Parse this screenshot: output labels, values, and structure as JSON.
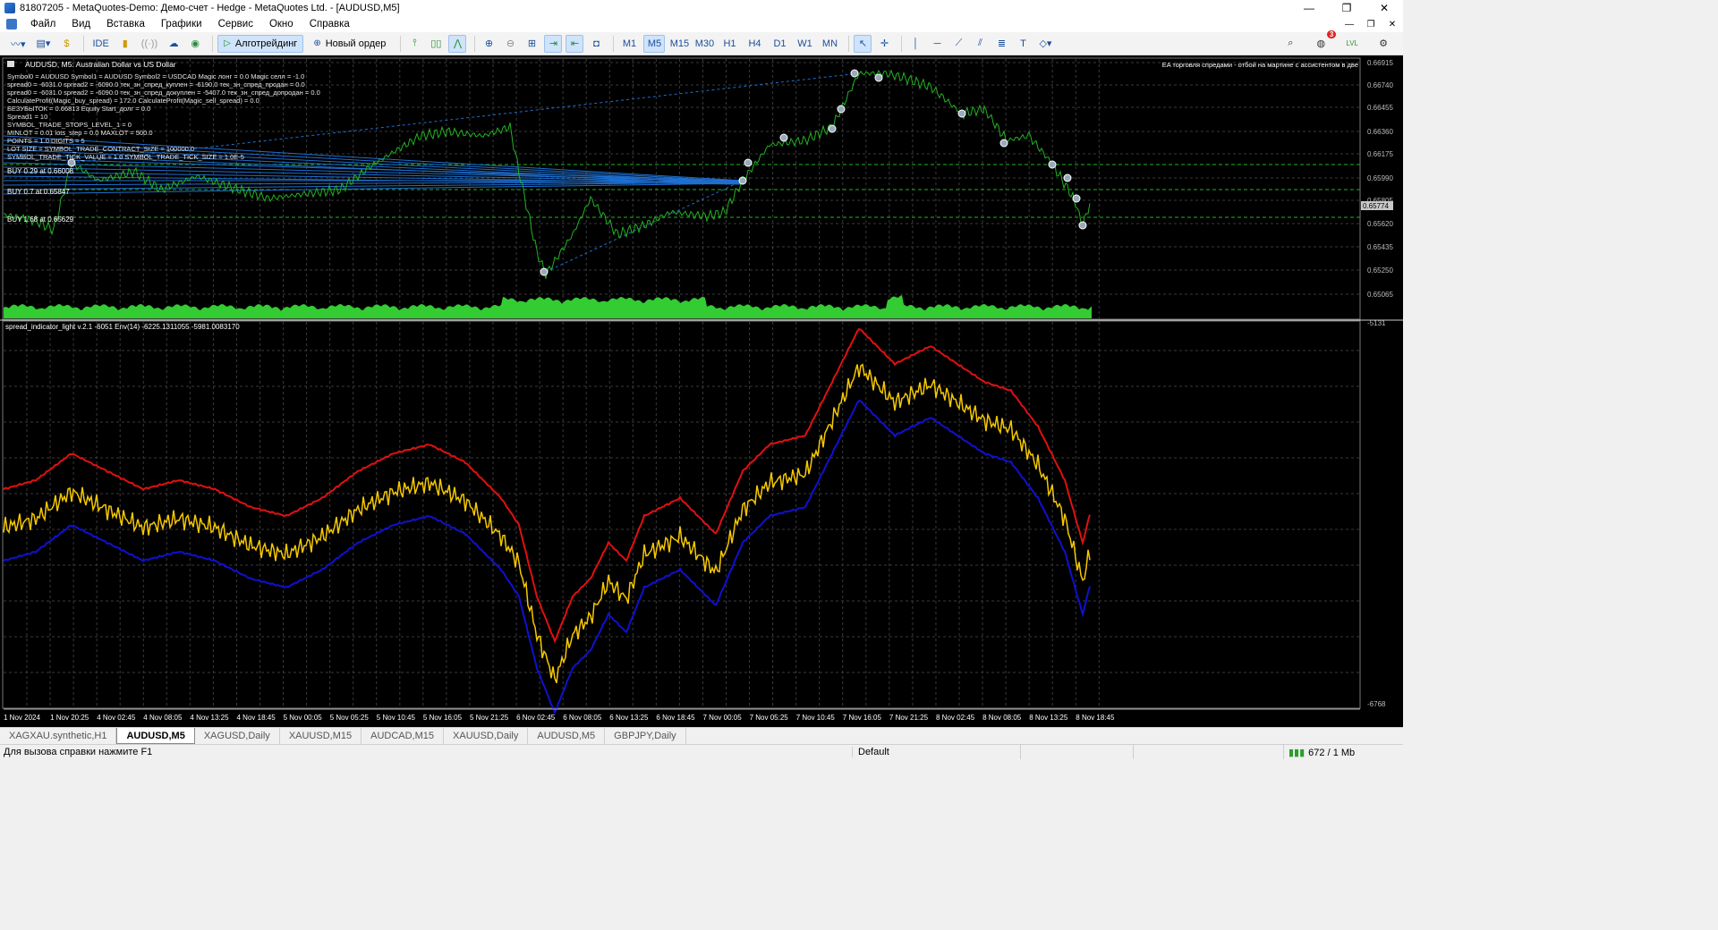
{
  "window": {
    "title": "81807205 - MetaQuotes-Demo: Демо-счет - Hedge - MetaQuotes Ltd. - [AUDUSD,M5]",
    "controls": [
      "—",
      "❐",
      "✕"
    ]
  },
  "menu": {
    "items": [
      "Файл",
      "Вид",
      "Вставка",
      "Графики",
      "Сервис",
      "Окно",
      "Справка"
    ],
    "mdi_controls": [
      "—",
      "❐",
      "✕"
    ]
  },
  "toolbar": {
    "ide_label": "IDE",
    "algotrading_label": "Алготрейдинг",
    "new_order_label": "Новый ордер",
    "timeframes": [
      "M1",
      "M5",
      "M15",
      "M30",
      "H1",
      "H4",
      "D1",
      "W1",
      "MN"
    ],
    "active_timeframe": "M5",
    "notifications_count": "3",
    "lvl_label": "LVL"
  },
  "chart": {
    "symbol_header": "AUDUSD, M5:  Australian Dollar vs US Dollar",
    "ea_label": "EA торговля спредами - отбой на мартине с ассистентом в две",
    "ea_info": [
      "Symbol0 = AUDUSD Symbol1 = AUDUSD Symbol2 = USDCAD Magic лонг = 0.0 Magic селл = -1.0",
      "spread0 = -6031.0 spread2 = -6090.0 тек_зн_спред_куплен = -6190.0   тек_зн_спред_продан = 0.0",
      "spread0 = -6031.0 spread2 = -6090.0 тек_зн_спред_докуплен = -5407.0 тек_зн_спред_допродан = 0.0",
      "CalculateProfit(Magic_buy_spread) = 172.0 CalculateProfit(Magic_sell_spread) = 0.0",
      "БЕЗУБЫТОК = 0.66813 Equity Start_долг = 0.0",
      "Spread1 = 10",
      "SYMBOL_TRADE_STOPS_LEVEL_1 = 0",
      "MINLOT = 0.01 lots_step = 0.0 MAXLOT = 500.0",
      "POINTS = 1.0 DIGITS = 5",
      "LOT SIZE = SYMBOL_TRADE_CONTRACT_SIZE = 100000.0",
      "SYMBOL_TRADE_TICK_VALUE = 1.0 SYMBOL_TRADE_TICK_SIZE = 1.0E-5"
    ],
    "orders": [
      "BUY 0.29 at 0.66008",
      "BUY 0.7 at 0.65847",
      "BUY 1.68 at 0.65629"
    ],
    "price_axis": [
      "0.66915",
      "0.66740",
      "0.66455",
      "0.66360",
      "0.66175",
      "0.65990",
      "0.65805",
      "0.65620",
      "0.65435",
      "0.65250",
      "0.65065"
    ],
    "current_price": "0.65774",
    "indicator_label": "spread_indicator_light v.2.1 -6051 Env(14) -6225.1311055 -5981.0083170",
    "indicator_axis_top": "-5131",
    "indicator_axis_bottom": "-6768",
    "time_axis": [
      "1 Nov 2024",
      "1 Nov 20:25",
      "4 Nov 02:45",
      "4 Nov 08:05",
      "4 Nov 13:25",
      "4 Nov 18:45",
      "5 Nov 00:05",
      "5 Nov 05:25",
      "5 Nov 10:45",
      "5 Nov 16:05",
      "5 Nov 21:25",
      "6 Nov 02:45",
      "6 Nov 08:05",
      "6 Nov 13:25",
      "6 Nov 18:45",
      "7 Nov 00:05",
      "7 Nov 05:25",
      "7 Nov 10:45",
      "7 Nov 16:05",
      "7 Nov 21:25",
      "8 Nov 02:45",
      "8 Nov 08:05",
      "8 Nov 13:25",
      "8 Nov 18:45"
    ],
    "colors": {
      "price_line": "#22b322",
      "volume": "#33cc33",
      "grid": "#3a3a3a",
      "order_lines": "#1e6fd0",
      "env_upper": "#e01010",
      "env_lower": "#1010d0",
      "spread_line": "#f5c800"
    }
  },
  "tabs": {
    "items": [
      "XAGXAU.synthetic,H1",
      "AUDUSD,M5",
      "XAGUSD,Daily",
      "XAUUSD,M15",
      "AUDCAD,M15",
      "XAUUSD,Daily",
      "AUDUSD,M5",
      "GBPJPY,Daily"
    ],
    "active_index": 1
  },
  "status": {
    "help_text": "Для вызова справки нажмите F1",
    "profile": "Default",
    "connection": "672 / 1 Mb"
  }
}
